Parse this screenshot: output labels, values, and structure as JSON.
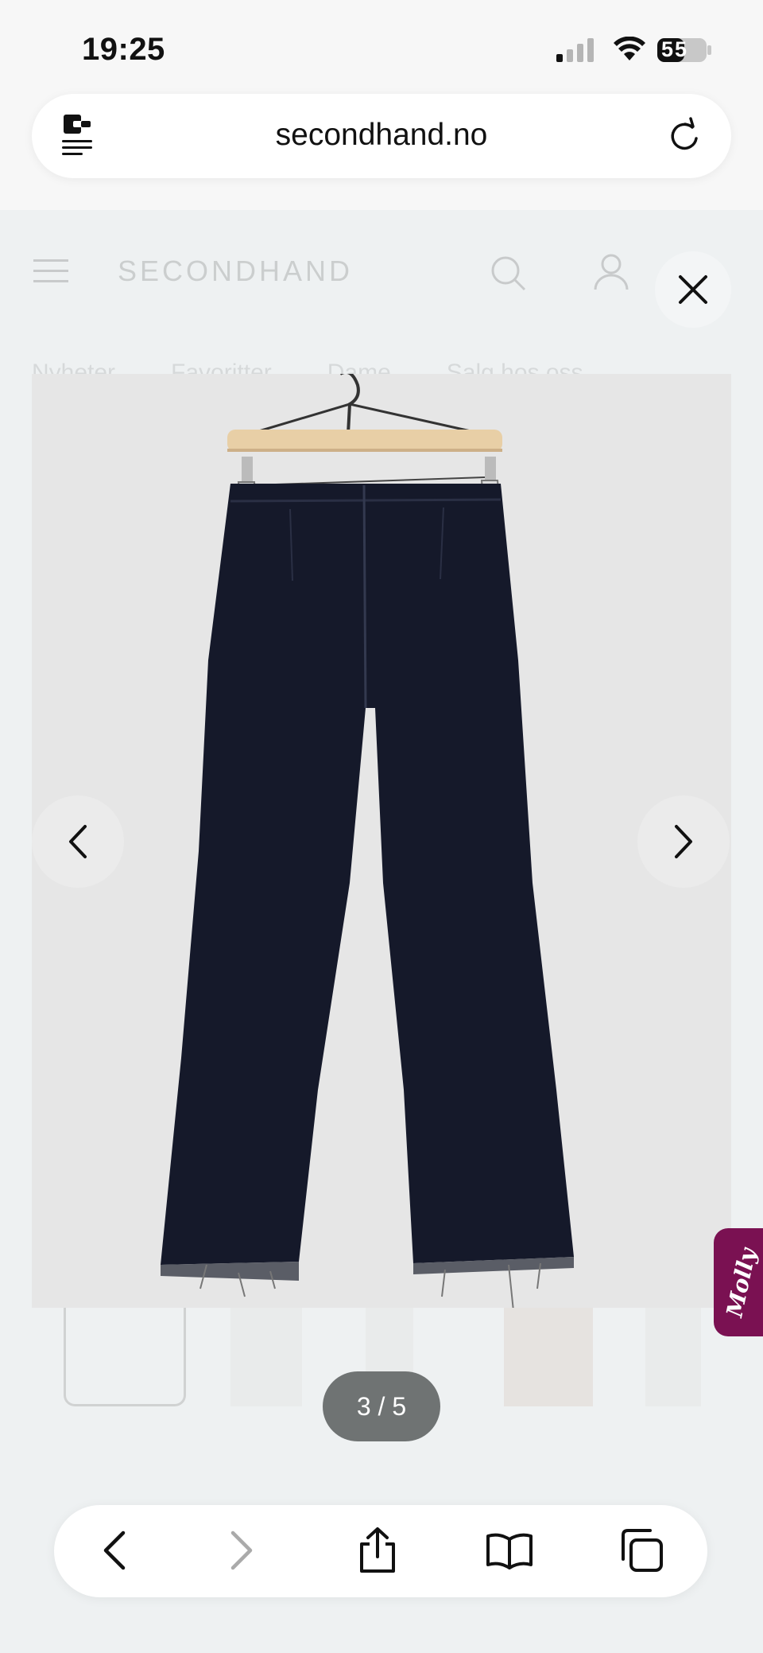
{
  "status_bar": {
    "time": "19:25",
    "battery": "55"
  },
  "browser": {
    "url": "secondhand.no"
  },
  "site": {
    "brand": "SECONDHAND",
    "nav": [
      "Nyheter",
      "Favoritter",
      "Dame",
      "Salg hos oss"
    ]
  },
  "viewer": {
    "counter": "3 / 5",
    "current_index": 3,
    "total": 5,
    "thumbnail_count": 5
  },
  "widget": {
    "molly_label": "Molly"
  },
  "colors": {
    "molly": "#7a1152",
    "counter_bg": "#6f7373",
    "jeans": "#15192a"
  },
  "icons": {
    "close": "close-icon",
    "prev": "chevron-left-icon",
    "next": "chevron-right-icon",
    "back": "back-icon",
    "forward": "forward-icon",
    "share": "share-icon",
    "bookmarks": "bookmarks-icon",
    "tabs": "tabs-icon"
  }
}
